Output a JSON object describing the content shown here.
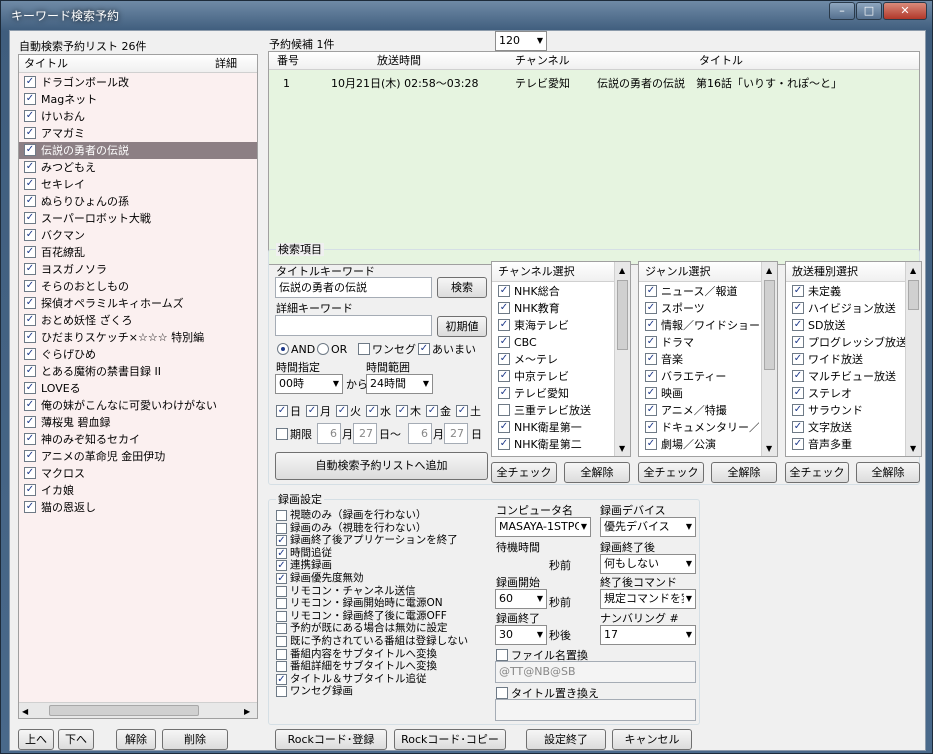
{
  "window": {
    "title": "キーワード検索予約",
    "min": "–",
    "max": "□",
    "close": "✕"
  },
  "left": {
    "header": "自動検索予約リスト 26件",
    "col_title": "タイトル",
    "col_detail": "詳細",
    "selected_index": 4,
    "items": [
      "ドラゴンボール改",
      "Magネット",
      "けいおん",
      "アマガミ",
      "伝説の勇者の伝説",
      "みつどもえ",
      "セキレイ",
      "ぬらりひょんの孫",
      "スーパーロボット大戦",
      "バクマン",
      "百花繚乱",
      "ヨスガノソラ",
      "そらのおとしもの",
      "探偵オペラミルキィホームズ",
      "おとめ妖怪 ざくろ",
      "ひだまりスケッチ×☆☆☆ 特別編",
      "ぐらげひめ",
      "とある魔術の禁書目録 II",
      "LOVEる",
      "俺の妹がこんなに可愛いわけがない",
      "薄桜鬼 碧血録",
      "神のみぞ知るセカイ",
      "アニメの革命児 金田伊功",
      "マクロス",
      "イカ娘",
      "猫の恩返し"
    ],
    "buttons": {
      "up": "上へ",
      "down": "下へ",
      "unset": "解除",
      "delete": "削除"
    }
  },
  "candidates": {
    "header": "予約候補 1件",
    "cols": [
      "番号",
      "放送時間",
      "チャンネル",
      "タイトル"
    ],
    "rows": [
      {
        "no": "1",
        "time": "10月21日(木) 02:58～03:28",
        "channel": "テレビ愛知",
        "title": "伝説の勇者の伝説　第16話「いりす・れぽ～と」"
      }
    ]
  },
  "search": {
    "group": "検索項目",
    "title_kw_label": "タイトルキーワード",
    "title_kw": "伝説の勇者の伝説",
    "search_btn": "検索",
    "detail_kw_label": "詳細キーワード",
    "detail_kw": "",
    "init_btn": "初期値",
    "and": "AND",
    "or": "OR",
    "oneseg": "ワンセグ",
    "aimai": "あいまい",
    "time_label": "時間指定",
    "time_val": "00時",
    "from": "から",
    "range_label": "時間範囲",
    "range_val": "24時間",
    "days": [
      "日",
      "月",
      "火",
      "水",
      "木",
      "金",
      "土"
    ],
    "period": "期限",
    "m1": "6",
    "d1": "27",
    "m2": "6",
    "d2": "27",
    "mon": "月",
    "day": "日",
    "tilde": "日～",
    "add_btn": "自動検索予約リストへ追加"
  },
  "channels": {
    "header": "チャンネル選択",
    "items": [
      [
        "NHK総合",
        true
      ],
      [
        "NHK教育",
        true
      ],
      [
        "東海テレビ",
        true
      ],
      [
        "CBC",
        true
      ],
      [
        "メ～テレ",
        true
      ],
      [
        "中京テレビ",
        true
      ],
      [
        "テレビ愛知",
        true
      ],
      [
        "三重テレビ放送",
        false
      ],
      [
        "NHK衛星第一",
        true
      ],
      [
        "NHK衛星第二",
        true
      ]
    ]
  },
  "genres": {
    "header": "ジャンル選択",
    "items": [
      "ニュース／報道",
      "スポーツ",
      "情報／ワイドショー",
      "ドラマ",
      "音楽",
      "バラエティー",
      "映画",
      "アニメ／特撮",
      "ドキュメンタリー／…",
      "劇場／公演"
    ]
  },
  "types": {
    "header": "放送種別選択",
    "items": [
      "未定義",
      "ハイビジョン放送",
      "SD放送",
      "プログレッシブ放送",
      "ワイド放送",
      "マルチビュー放送",
      "ステレオ",
      "サラウンド",
      "文字放送",
      "音声多重"
    ]
  },
  "check_all": "全チェック",
  "uncheck_all": "全解除",
  "rec": {
    "group": "録画設定",
    "options": [
      [
        "視聴のみ（録画を行わない）",
        false
      ],
      [
        "録画のみ（視聴を行わない）",
        false
      ],
      [
        "録画終了後アプリケーションを終了",
        true
      ],
      [
        "時間追従",
        true
      ],
      [
        "連携録画",
        true
      ],
      [
        "録画優先度無効",
        true
      ],
      [
        "リモコン・チャンネル送信",
        false
      ],
      [
        "リモコン・録画開始時に電源ON",
        false
      ],
      [
        "リモコン・録画終了後に電源OFF",
        false
      ],
      [
        "予約が既にある場合は無効に設定",
        false
      ],
      [
        "既に予約されている番組は登録しない",
        false
      ],
      [
        "番組内容をサブタイトルへ変換",
        false
      ],
      [
        "番組詳細をサブタイトルへ変換",
        false
      ],
      [
        "タイトル＆サブタイトル追従",
        true
      ],
      [
        "ワンセグ録画",
        false
      ]
    ],
    "computer_label": "コンピュータ名",
    "computer": "MASAYA-1STPC",
    "device_label": "録画デバイス",
    "device": "優先デバイス",
    "wait_label": "待機時間",
    "wait": "120",
    "sec_before": "秒前",
    "after_label": "録画終了後",
    "after": "何もしない",
    "start_label": "録画開始",
    "start": "60",
    "cmd_label": "終了後コマンド",
    "cmd": "規定コマンドを実",
    "end_label": "録画終了",
    "end": "30",
    "sec_after": "秒後",
    "num_label": "ナンバリング #",
    "num": "17",
    "fname_label": "ファイル名置換",
    "fname": "@TT@NB@SB",
    "title_replace_label": "タイトル置き換え"
  },
  "bottom": {
    "rock_reg": "Rockコード･登録",
    "rock_copy": "Rockコード･コピー",
    "done": "設定終了",
    "cancel": "キャンセル"
  }
}
